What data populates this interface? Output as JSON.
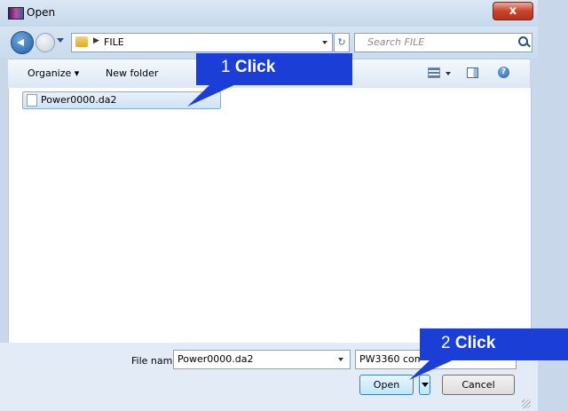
{
  "window": {
    "title": "Open",
    "close_label": "x"
  },
  "address_bar": {
    "breadcrumb": "FILE",
    "search_placeholder": "Search FILE"
  },
  "toolbar": {
    "organize": "Organize ▾",
    "new_folder": "New folder"
  },
  "files": [
    {
      "name": "Power0000.da2"
    }
  ],
  "bottom": {
    "file_name_label": "File name:",
    "file_name_value": "Power0000.da2",
    "filter_value": "PW3360 com",
    "open_label": "Open",
    "cancel_label": "Cancel"
  },
  "annotations": {
    "step1": {
      "number": "1",
      "word": "Click"
    },
    "step2": {
      "number": "2",
      "word": "Click"
    }
  },
  "colors": {
    "callout": "#1b3fd6",
    "titlebar": "#c6d8ec",
    "close": "#c9432e"
  }
}
